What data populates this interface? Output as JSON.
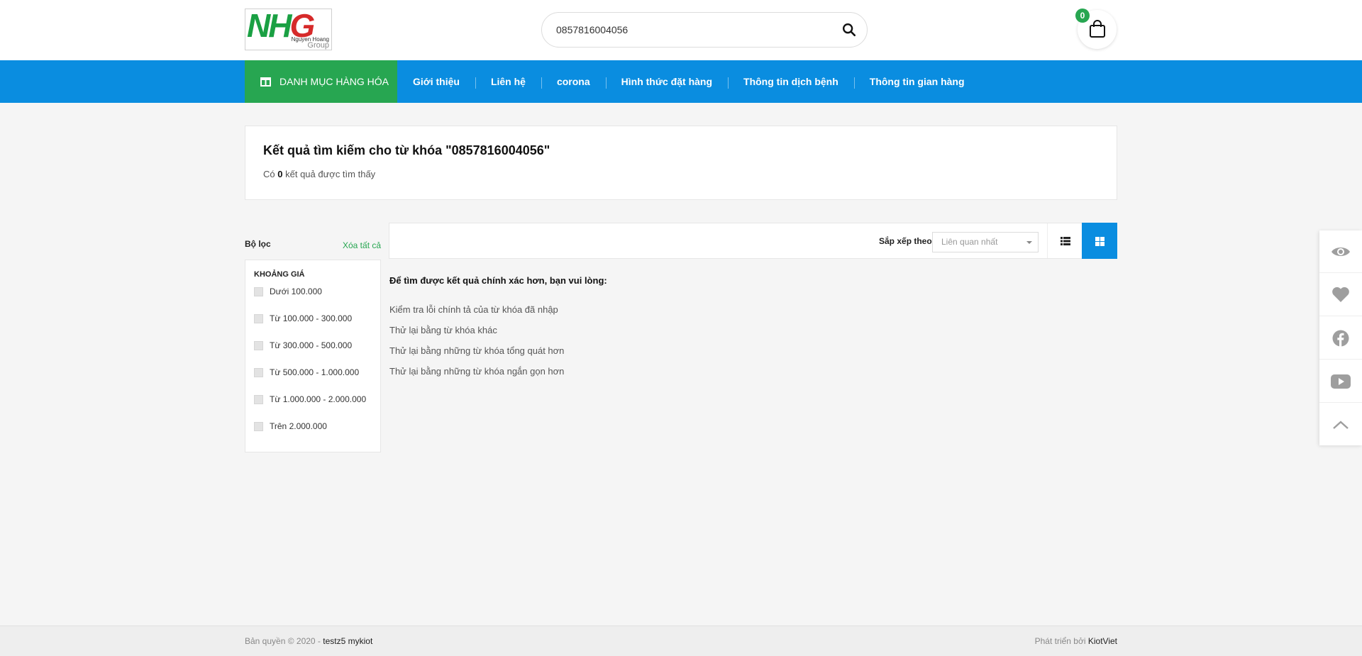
{
  "header": {
    "logo": {
      "letters_n": "N",
      "letters_h": "H",
      "letters_g": "G",
      "line1": "Nguyen Hoang",
      "line2": "Group"
    },
    "search": {
      "value": "0857816004056",
      "icon": "search-icon"
    },
    "cart": {
      "count": "0",
      "icon": "shopping-bag-icon"
    }
  },
  "nav": {
    "category_label": "DANH MỤC HÀNG HÓA",
    "items": [
      {
        "label": "Giới thiệu"
      },
      {
        "label": "Liên hệ"
      },
      {
        "label": "corona"
      },
      {
        "label": "Hình thức đặt hàng"
      },
      {
        "label": "Thông tin dịch bệnh"
      },
      {
        "label": "Thông tin gian hàng"
      }
    ]
  },
  "results": {
    "title": "Kết quả tìm kiếm cho từ khóa \"0857816004056\"",
    "count_prefix": "Có",
    "count": "0",
    "count_suffix": "kết quả được tìm thấy"
  },
  "filter": {
    "title": "Bộ lọc",
    "clear_all": "Xóa tất cả",
    "price_heading": "KHOẢNG GIÁ",
    "options": [
      {
        "label": "Dưới 100.000"
      },
      {
        "label": "Từ 100.000 - 300.000"
      },
      {
        "label": "Từ 300.000 - 500.000"
      },
      {
        "label": "Từ 500.000 - 1.000.000"
      },
      {
        "label": "Từ 1.000.000 - 2.000.000"
      },
      {
        "label": "Trên 2.000.000"
      }
    ]
  },
  "toolbar": {
    "sort_label": "Sắp xếp theo",
    "sort_value": "Liên quan nhất",
    "active_view": "grid"
  },
  "suggestions": {
    "title": "Để tìm được kết quả chính xác hơn, bạn vui lòng:",
    "items": [
      "Kiểm tra lỗi chính tả của từ khóa đã nhập",
      "Thử lại bằng từ khóa khác",
      "Thử lại bằng những từ khóa tổng quát hơn",
      "Thử lại bằng những từ khóa ngắn gọn hơn"
    ]
  },
  "floating_bar": [
    "eye-icon",
    "heart-icon",
    "facebook-icon",
    "youtube-icon",
    "chevron-up-icon"
  ],
  "footer": {
    "copyright": "Bản quyền © 2020 -",
    "site_name": "testz5 mykiot",
    "developed_by": "Phát triển bởi",
    "developer": "KiotViet"
  },
  "colors": {
    "primary": "#0a8de0",
    "accent": "#27a651",
    "logo_red": "#d62a2a"
  }
}
